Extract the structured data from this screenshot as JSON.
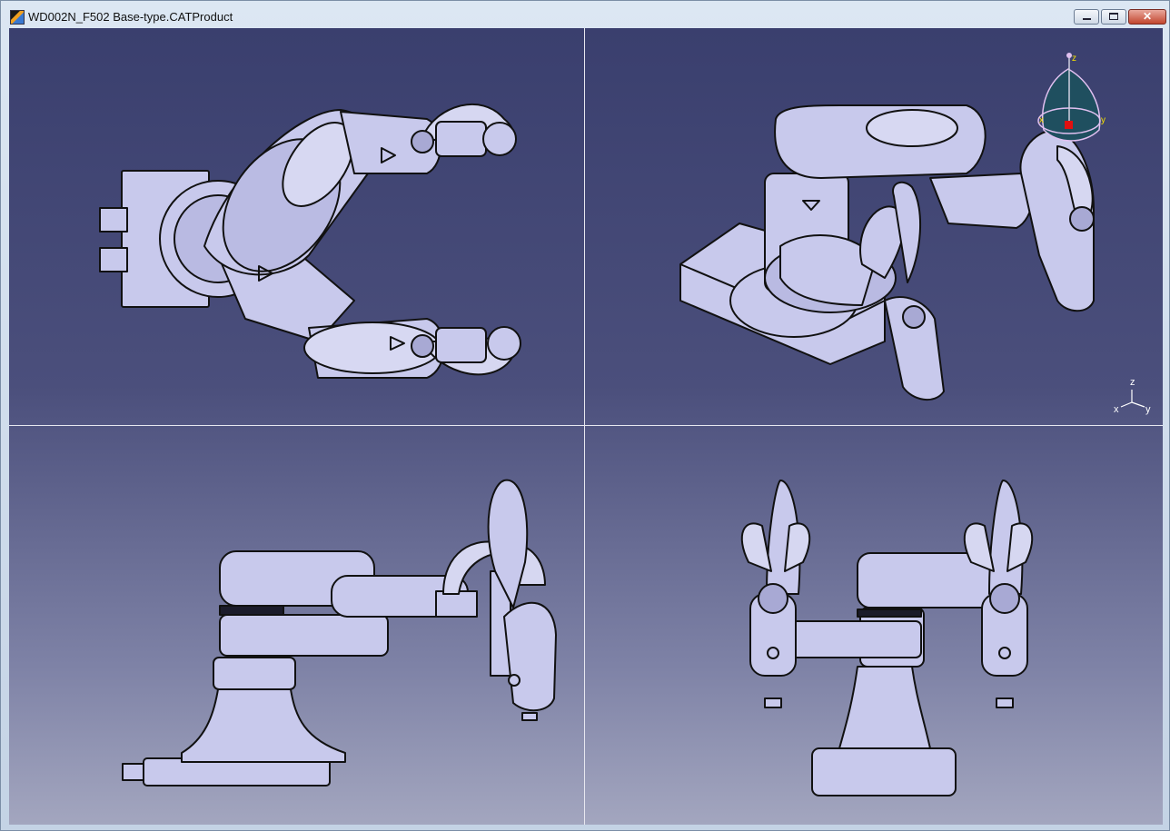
{
  "window": {
    "title": "WD002N_F502 Base-type.CATProduct",
    "controls": {
      "minimize": "minimize",
      "maximize": "maximize",
      "close": "✕"
    }
  },
  "viewer": {
    "layout": "4-pane",
    "panes": [
      "top view",
      "isometric view",
      "front view",
      "right view"
    ],
    "colors": {
      "background_top": "#3a3f6e",
      "background_bottom": "#a3a6bf",
      "model_fill": "#c8c9ec",
      "model_edge": "#111111"
    }
  },
  "compass": {
    "z": "z",
    "x": "x",
    "y": "y",
    "fill": "#1f4f5f",
    "handle": "#e01010"
  },
  "axis_triad": {
    "z": "z",
    "x": "x",
    "y": "y"
  }
}
